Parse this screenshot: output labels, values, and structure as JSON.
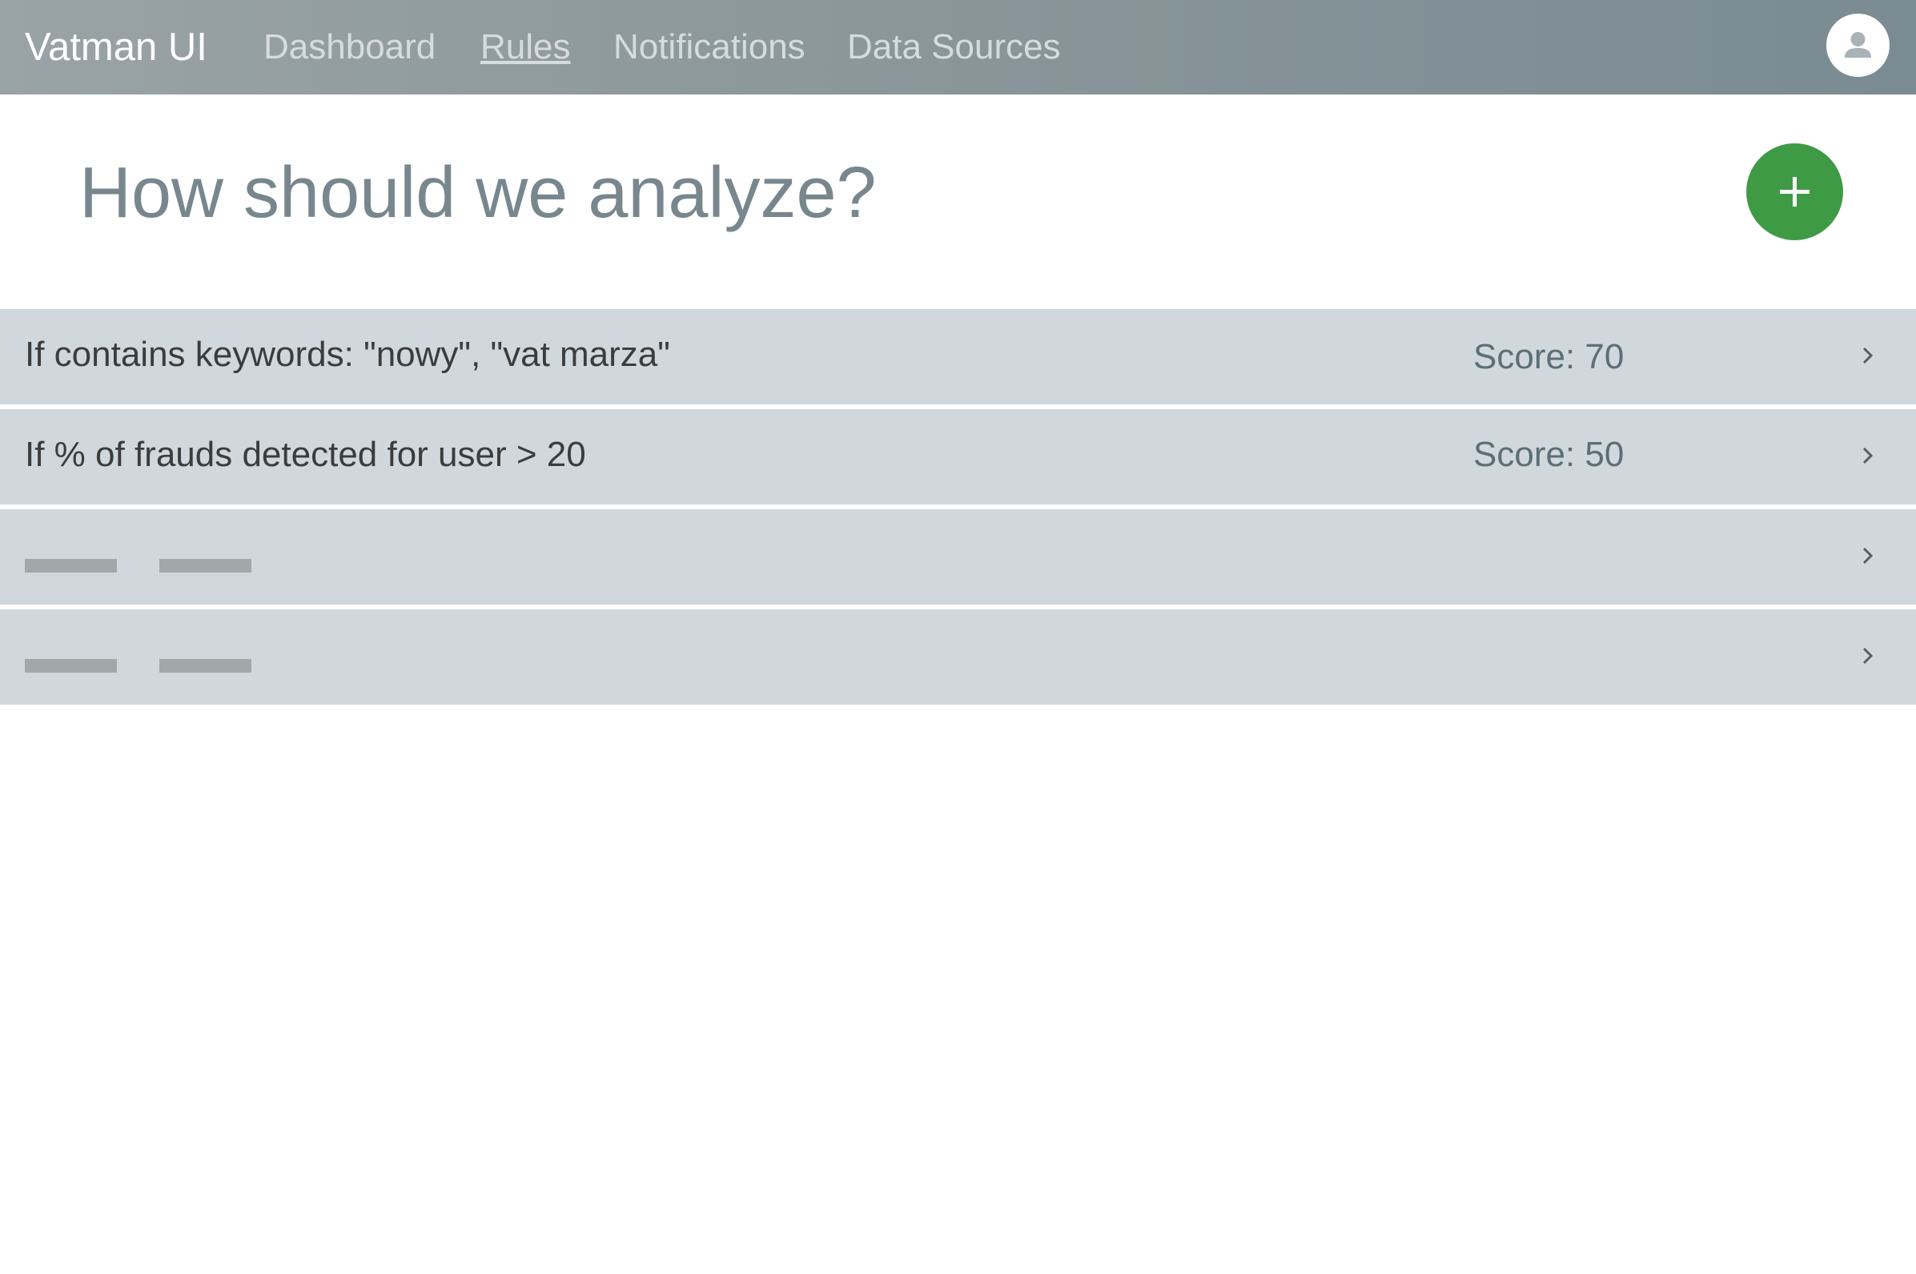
{
  "app": {
    "brand": "Vatman UI"
  },
  "nav": {
    "items": [
      {
        "label": "Dashboard",
        "active": false
      },
      {
        "label": "Rules",
        "active": true
      },
      {
        "label": "Notifications",
        "active": false
      },
      {
        "label": "Data Sources",
        "active": false
      }
    ]
  },
  "header": {
    "title": "How should we analyze?",
    "add_button_icon": "plus-icon",
    "account_icon": "user-icon"
  },
  "rules": [
    {
      "condition": "If contains keywords: \"nowy\", \"vat marza\"",
      "score": "Score: 70"
    },
    {
      "condition": "If % of frauds detected for user > 20",
      "score": "Score: 50"
    },
    {
      "placeholder": true
    },
    {
      "placeholder": true
    }
  ],
  "colors": {
    "accent_green": "#3f9a45",
    "row_background": "#d0d8de",
    "title_color": "#78878e"
  }
}
